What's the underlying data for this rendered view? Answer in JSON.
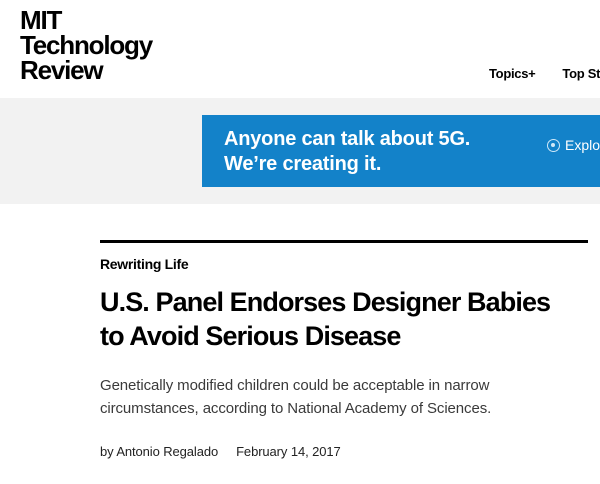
{
  "header": {
    "logo_lines": [
      "MIT",
      "Technology",
      "Review"
    ],
    "nav": [
      "Topics+",
      "Top Sto"
    ]
  },
  "ad": {
    "line1": "Anyone can talk about 5G.",
    "line2": "We’re creating it.",
    "cta": "Explo",
    "background_color": "#1382c9"
  },
  "article": {
    "kicker": "Rewriting Life",
    "headline": "U.S. Panel Endorses Designer Babies to Avoid Serious Disease",
    "dek": "Genetically modified children could be acceptable in narrow circumstances, according to National Academy of Sciences.",
    "author": "by Antonio Regalado",
    "date": "February 14, 2017"
  }
}
